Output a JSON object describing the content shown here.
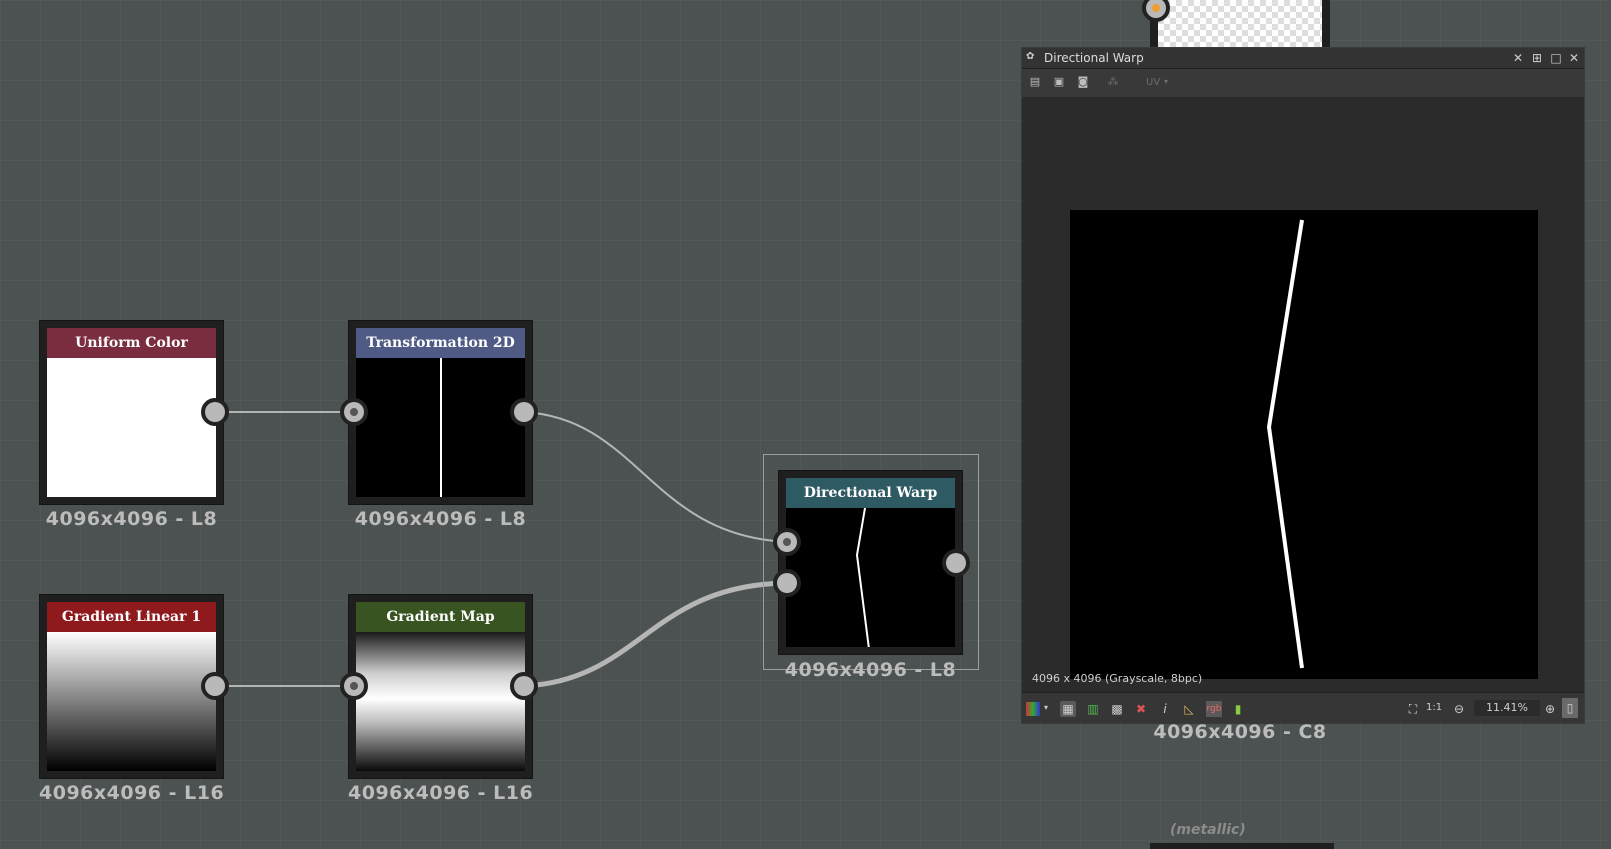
{
  "canvas": {
    "nodes": [
      {
        "title": "Uniform Color",
        "size": "4096x4096 - L8",
        "title_color": "#7a2d3e"
      },
      {
        "title": "Transformation 2D",
        "size": "4096x4096 - L8",
        "title_color": "#4f5a85"
      },
      {
        "title": "Gradient Linear 1",
        "size": "4096x4096 - L16",
        "title_color": "#8e1a1e"
      },
      {
        "title": "Gradient Map",
        "size": "4096x4096 - L16",
        "title_color": "#385420"
      },
      {
        "title": "Directional Warp",
        "size": "4096x4096 - L8",
        "title_color": "#2d5a63"
      }
    ],
    "offscreen_output_size": "4096x4096 - C8",
    "metallic_label": "(metallic)"
  },
  "viewer": {
    "title": "Directional Warp",
    "toolbar_uv": "UV",
    "info": "4096 x 4096 (Grayscale, 8bpc)",
    "ratio_label": "1:1",
    "zoom": "11.41%",
    "icons": [
      "pin-icon",
      "restore-icon",
      "maximize-icon",
      "close-icon"
    ]
  },
  "colors": {
    "background": "#4c5152",
    "wire": "#b5b5b5",
    "orange_port": "#f0a030"
  }
}
